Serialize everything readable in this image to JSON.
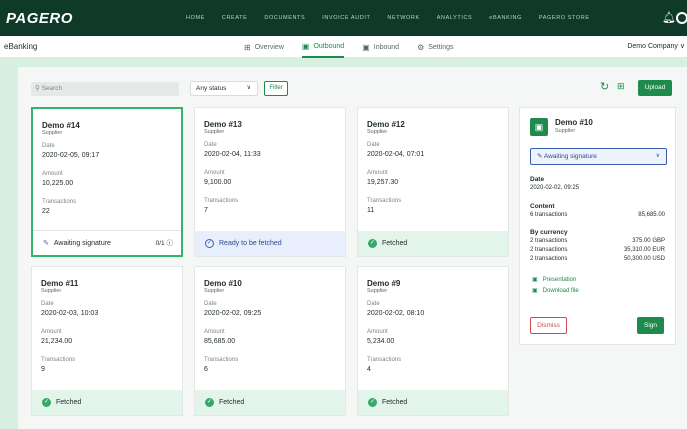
{
  "brand": {
    "logo": "PAGERO"
  },
  "topnav": [
    "HOME",
    "CREATE",
    "DOCUMENTS",
    "INVOICE AUDIT",
    "NETWORK",
    "ANALYTICS",
    "eBANKING",
    "PAGERO STORE"
  ],
  "subbar": {
    "app_name": "eBanking",
    "tabs": [
      {
        "label": "Overview",
        "icon": "grid-icon"
      },
      {
        "label": "Outbound",
        "icon": "document-icon"
      },
      {
        "label": "Inbound",
        "icon": "document-icon"
      },
      {
        "label": "Settings",
        "icon": "gear-icon"
      }
    ],
    "company": "Demo Company ∨"
  },
  "toolbar": {
    "search_placeholder": "Search",
    "status_value": "Any status",
    "filter_label": "Filter",
    "upload_label": "Upload"
  },
  "labels": {
    "date": "Date",
    "amount": "Amount",
    "transactions": "Transactions"
  },
  "cards": [
    {
      "title": "Demo #14",
      "role": "Supplier",
      "date": "2020-02-05, 09:17",
      "amount": "10,225.00",
      "transactions": "22",
      "status": "Awaiting signature",
      "progress": "0/1"
    },
    {
      "title": "Demo #13",
      "role": "Supplier",
      "date": "2020-02-04, 11:33",
      "amount": "9,100.00",
      "transactions": "7",
      "status": "Ready to be fetched"
    },
    {
      "title": "Demo #12",
      "role": "Supplier",
      "date": "2020-02-04, 07:01",
      "amount": "19,257.30",
      "transactions": "11",
      "status": "Fetched"
    },
    {
      "title": "Demo #11",
      "role": "Supplier",
      "date": "2020-02-03, 10:03",
      "amount": "21,234.00",
      "transactions": "9",
      "status": "Fetched"
    },
    {
      "title": "Demo #10",
      "role": "Supplier",
      "date": "2020-02-02, 09:25",
      "amount": "85,685.00",
      "transactions": "6",
      "status": "Fetched"
    },
    {
      "title": "Demo #9",
      "role": "Supplier",
      "date": "2020-02-02, 08:10",
      "amount": "5,234.00",
      "transactions": "4",
      "status": "Fetched"
    }
  ],
  "detail": {
    "title": "Demo #10",
    "role": "Supplier",
    "status_value": "Awaiting signature",
    "date_label": "Date",
    "date": "2020-02-02, 09:25",
    "content_label": "Content",
    "content_count": "6 transactions",
    "content_total": "85,685.00",
    "currency_label": "By currency",
    "currency_rows": [
      {
        "count": "2 transactions",
        "amount": "375.00 GBP"
      },
      {
        "count": "2 transactions",
        "amount": "35,310.00 EUR"
      },
      {
        "count": "2 transactions",
        "amount": "50,300.00 USD"
      }
    ],
    "link_presentation": "Presentation",
    "link_download": "Download file",
    "dismiss_label": "Dismiss",
    "sign_label": "Sign"
  },
  "colors": {
    "brand_dark": "#0f3a29",
    "accent": "#1e8a4c",
    "fetched_bg": "#e3f4ea",
    "ready_bg": "#e8eefb",
    "danger": "#d14b4b"
  }
}
